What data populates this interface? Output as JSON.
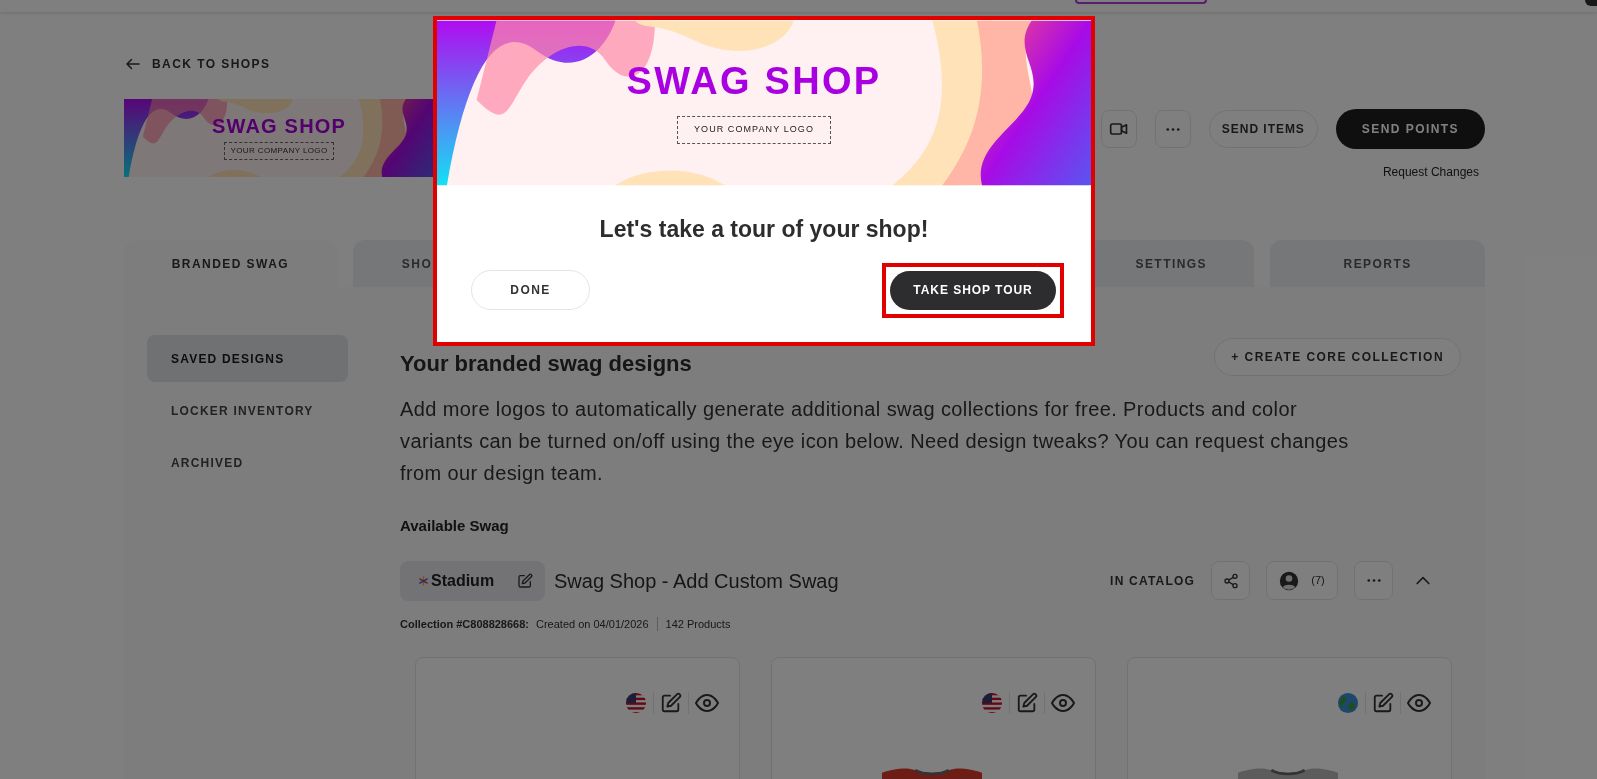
{
  "back_link": "BACK TO SHOPS",
  "shop_banner": {
    "title": "SWAG SHOP",
    "logo_placeholder": "YOUR COMPANY LOGO"
  },
  "actions": [
    {
      "kind": "video"
    },
    {
      "kind": "more"
    },
    {
      "kind": "secondary",
      "label": "SEND ITEMS"
    },
    {
      "kind": "primary",
      "label": "SEND POINTS"
    }
  ],
  "request_changes": "Request Changes",
  "tabs": [
    {
      "label": "BRANDED SWAG",
      "selected": true
    },
    {
      "label": "SHO",
      "selected": false
    },
    {
      "label": "SETTINGS",
      "selected": false
    },
    {
      "label": "REPORTS",
      "selected": false
    }
  ],
  "sidebar": {
    "items": [
      {
        "label": "SAVED DESIGNS",
        "selected": true
      },
      {
        "label": "LOCKER INVENTORY",
        "selected": false
      },
      {
        "label": "ARCHIVED",
        "selected": false
      }
    ]
  },
  "section": {
    "title": "Your branded swag designs",
    "create_button": "+ CREATE CORE COLLECTION",
    "description": "Add more logos to automatically generate additional swag collections for free. Products and color variants can be turned on/off using the eye icon below. Need design tweaks? You can request changes from our design team.",
    "available_label": "Available Swag"
  },
  "collection": {
    "brand": "Stadium",
    "name": "Swag Shop - Add Custom Swag",
    "status": "IN CATALOG",
    "member_count": "(7)",
    "id_label": "Collection #C808828668:",
    "created": "Created on 04/01/2026",
    "products": "142 Products",
    "expanded": true
  },
  "product_cards": [
    {
      "kind": "us",
      "photo": false
    },
    {
      "kind": "us",
      "photo": true
    },
    {
      "kind": "global",
      "photo": true
    }
  ],
  "dialog": {
    "banner_title": "SWAG SHOP",
    "logo_placeholder": "YOUR COMPANY LOGO",
    "heading": "Let's take a tour of your shop!",
    "buttons": [
      {
        "kind": "secondary",
        "label": "DONE",
        "highlighted": false
      },
      {
        "kind": "primary",
        "label": "TAKE SHOP TOUR",
        "highlighted": true
      }
    ]
  }
}
